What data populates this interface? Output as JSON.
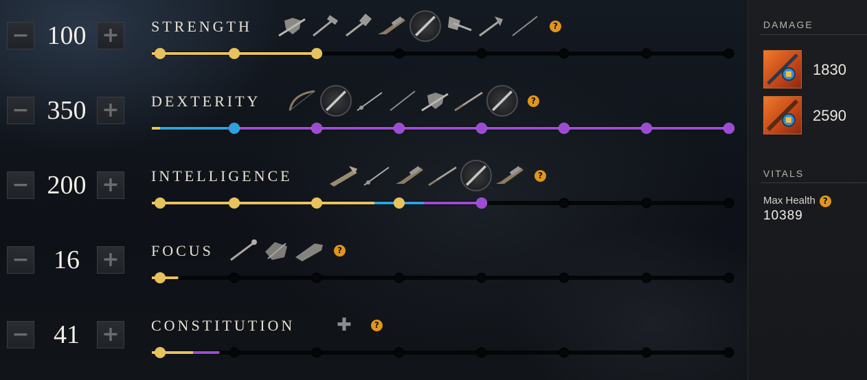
{
  "attributes": [
    {
      "name": "STRENGTH",
      "value": "100",
      "progress": 100
    },
    {
      "name": "DEXTERITY",
      "value": "350",
      "progress": 350
    },
    {
      "name": "INTELLIGENCE",
      "value": "200",
      "progress": 200
    },
    {
      "name": "FOCUS",
      "value": "16",
      "progress": 16
    },
    {
      "name": "CONSTITUTION",
      "value": "41",
      "progress": 41
    }
  ],
  "buttons": {
    "minus_glyph": "−",
    "plus_glyph": "+"
  },
  "help_glyph": "?",
  "constitution_plus_glyph": "✚",
  "colors": {
    "gold": "#e8c25a",
    "blue": "#2aa3e0",
    "purple": "#9d4bd6",
    "track": "#050608",
    "help": "#e0961b"
  },
  "weapon_icons": {
    "strength": [
      "sword-and-shield-icon",
      "war-hammer-icon",
      "great-hammer-icon",
      "blunderbuss-icon",
      "great-sword-icon",
      "great-axe-icon",
      "hatchet-icon",
      "spear-icon"
    ],
    "dexterity": [
      "bow-icon",
      "great-sword-icon",
      "rapier-icon",
      "spear-icon",
      "sword-and-shield-icon",
      "musket-icon",
      "great-sword-icon"
    ],
    "intelligence": [
      "fire-staff-icon",
      "rapier-icon",
      "blunderbuss-icon",
      "musket-icon",
      "great-sword-icon",
      "blunderbuss-icon"
    ],
    "focus": [
      "life-staff-icon",
      "ice-gauntlet-icon",
      "void-gauntlet-icon"
    ]
  },
  "sidebar": {
    "damage_heading": "DAMAGE",
    "damage": [
      {
        "value": "1830",
        "icon": "musket-weapon-icon"
      },
      {
        "value": "2590",
        "icon": "bow-weapon-icon"
      }
    ],
    "vitals_heading": "VITALS",
    "max_health_label": "Max Health",
    "max_health_value": "10389"
  },
  "track_milestones": [
    5,
    50,
    100,
    150,
    200,
    250,
    300,
    350
  ]
}
